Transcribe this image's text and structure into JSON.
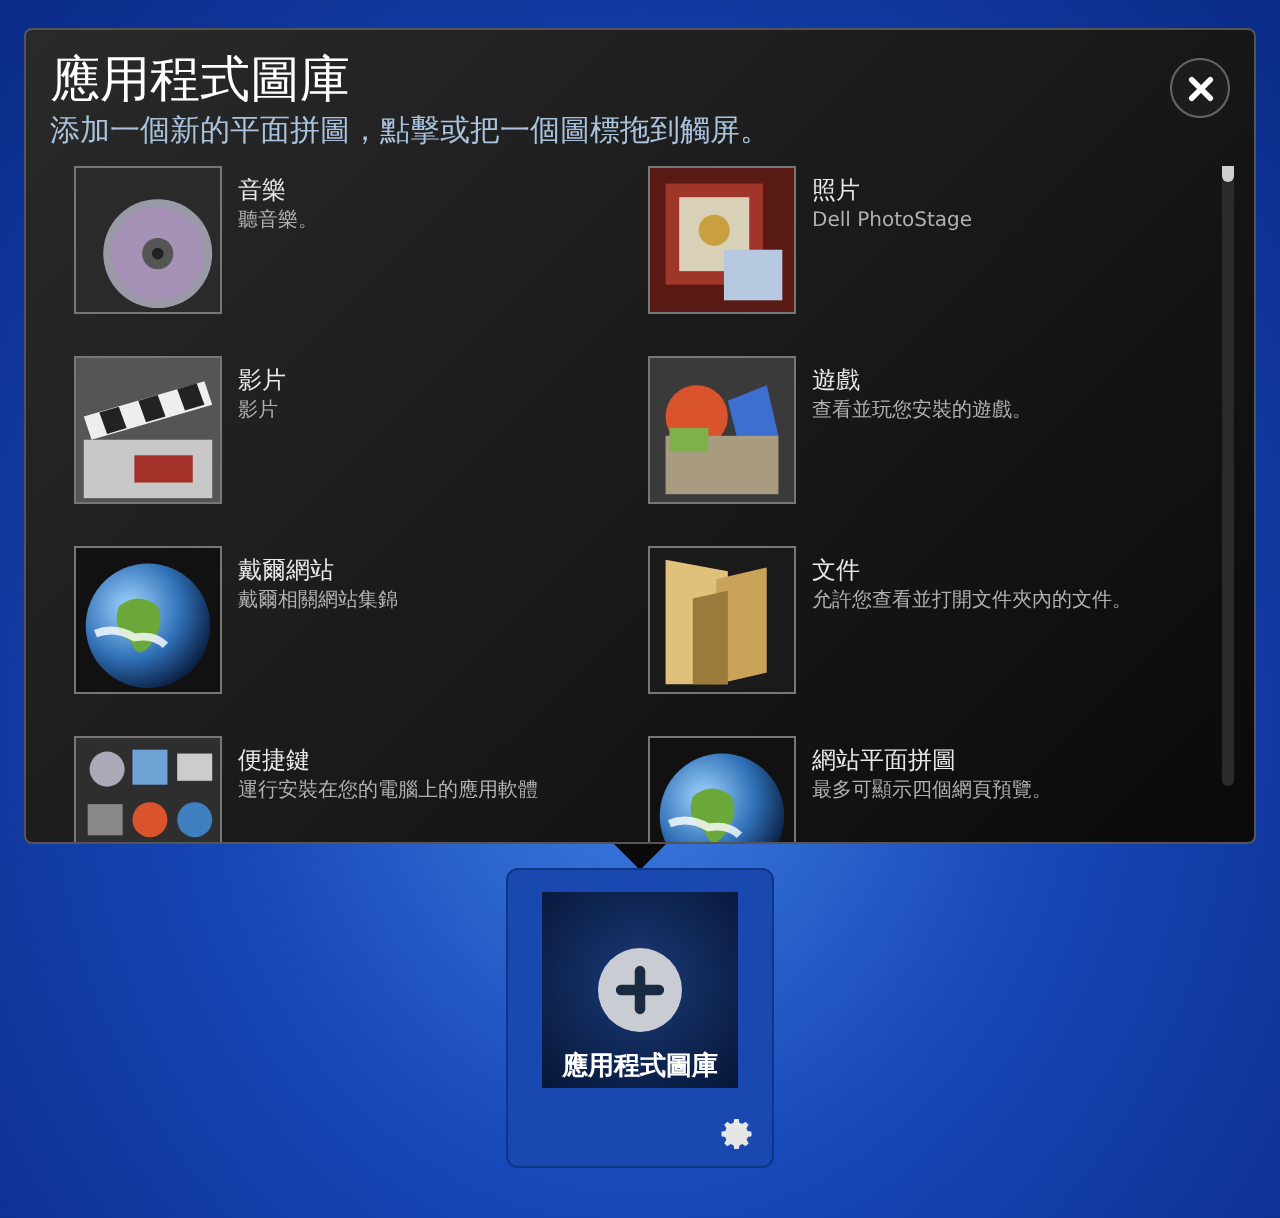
{
  "gallery": {
    "title": "應用程式圖庫",
    "subtitle": "添加一個新的平面拼圖，點擊或把一個圖標拖到觸屏。",
    "items": [
      {
        "kind": "music",
        "title": "音樂",
        "description": "聽音樂。"
      },
      {
        "kind": "photos",
        "title": "照片",
        "description": "Dell PhotoStage"
      },
      {
        "kind": "video",
        "title": "影片",
        "description": "影片"
      },
      {
        "kind": "games",
        "title": "遊戲",
        "description": "查看並玩您安裝的遊戲。"
      },
      {
        "kind": "web",
        "title": "戴爾網站",
        "description": "戴爾相關網站集錦"
      },
      {
        "kind": "folder",
        "title": "文件",
        "description": "允許您查看並打開文件夾內的文件。"
      },
      {
        "kind": "shortcuts",
        "title": "便捷鍵",
        "description": "運行安裝在您的電腦上的應用軟體"
      },
      {
        "kind": "web",
        "title": "網站平面拼圖",
        "description": "最多可顯示四個網頁預覽。"
      }
    ]
  },
  "tile": {
    "label": "應用程式圖庫"
  }
}
